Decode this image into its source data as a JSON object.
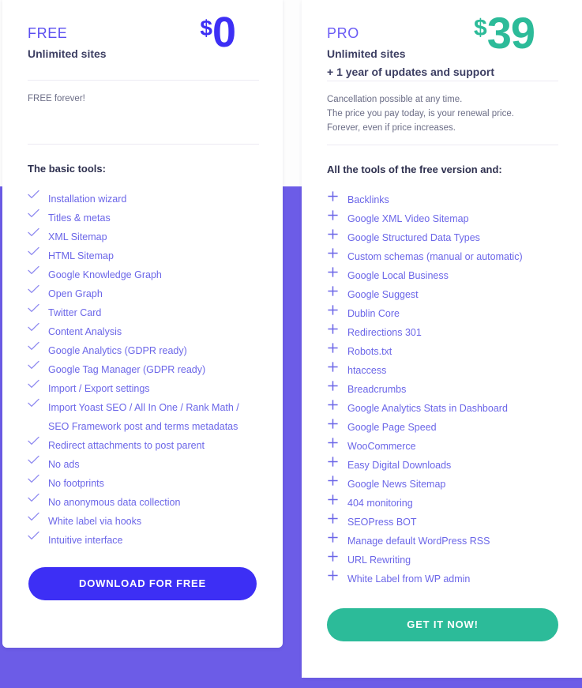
{
  "theme": {
    "page_background": "#6c5ce7",
    "card_background": "#ffffff",
    "free_accent": "#3d2ff5",
    "pro_accent": "#2cbb99",
    "feature_text": "#6b66e8",
    "heading_text": "#2f3150"
  },
  "plans": [
    {
      "id": "free",
      "name": "FREE",
      "subtitle": "Unlimited sites",
      "subtitle2": "",
      "currency": "$",
      "amount": "0",
      "notes": [
        "FREE forever!"
      ],
      "features_title": "The basic tools:",
      "feature_icon": "check-icon",
      "features": [
        "Installation wizard",
        "Titles & metas",
        "XML Sitemap",
        "HTML Sitemap",
        "Google Knowledge Graph",
        "Open Graph",
        "Twitter Card",
        "Content Analysis",
        "Google Analytics (GDPR ready)",
        "Google Tag Manager (GDPR ready)",
        "Import / Export settings",
        "Import Yoast SEO / All In One / Rank Math / SEO Framework post and terms metadatas",
        "Redirect attachments to post parent",
        "No ads",
        "No footprints",
        "No anonymous data collection",
        "White label via hooks",
        "Intuitive interface"
      ],
      "cta_label": "DOWNLOAD FOR FREE"
    },
    {
      "id": "pro",
      "name": "PRO",
      "subtitle": "Unlimited sites",
      "subtitle2": "+ 1 year of updates and support",
      "currency": "$",
      "amount": "39",
      "notes": [
        "Cancellation possible at any time.",
        "The price you pay today, is your renewal price.",
        "Forever, even if price increases."
      ],
      "features_title": "All the tools of the free version and:",
      "feature_icon": "plus-icon",
      "features": [
        "Backlinks",
        "Google XML Video Sitemap",
        "Google Structured Data Types",
        "Custom schemas (manual or automatic)",
        "Google Local Business",
        "Google Suggest",
        "Dublin Core",
        "Redirections 301",
        "Robots.txt",
        "htaccess",
        "Breadcrumbs",
        "Google Analytics Stats in Dashboard",
        "Google Page Speed",
        "WooCommerce",
        "Easy Digital Downloads",
        "Google News Sitemap",
        "404 monitoring",
        "SEOPress BOT",
        "Manage default WordPress RSS",
        "URL Rewriting",
        "White Label from WP admin"
      ],
      "cta_label": "GET IT NOW!"
    }
  ]
}
